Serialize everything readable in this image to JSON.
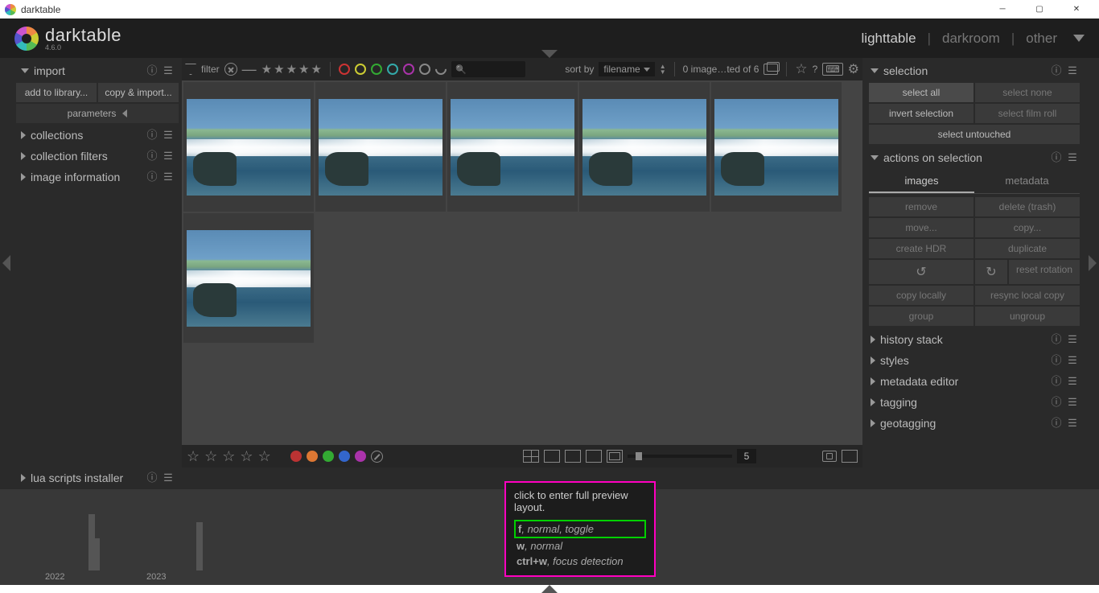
{
  "window": {
    "title": "darktable"
  },
  "app": {
    "name": "darktable",
    "version": "4.6.0"
  },
  "header_tabs": {
    "lighttable": "lighttable",
    "darkroom": "darkroom",
    "other": "other"
  },
  "left_panel": {
    "import": {
      "title": "import",
      "add_to_library": "add to library...",
      "copy_import": "copy & import...",
      "parameters": "parameters"
    },
    "collections": "collections",
    "collection_filters": "collection filters",
    "image_information": "image information",
    "lua": "lua scripts installer"
  },
  "toolbar": {
    "filter_label": "filter",
    "sort_by": "sort by",
    "sort_field": "filename",
    "count_text": "0 image…ted of 6",
    "zoom_value": "5",
    "colors": {
      "red": "#c33",
      "yellow": "#cc3",
      "green": "#3a3",
      "cyan": "#3aa",
      "magenta": "#a3a",
      "grey": "#888"
    },
    "dots": {
      "red": "#b33",
      "orange": "#d73",
      "green": "#3a3",
      "blue": "#36c",
      "magenta": "#a3a"
    }
  },
  "right_panel": {
    "selection": {
      "title": "selection",
      "select_all": "select all",
      "select_none": "select none",
      "invert": "invert selection",
      "film_roll": "select film roll",
      "untouched": "select untouched"
    },
    "actions": {
      "title": "actions on selection",
      "tab_images": "images",
      "tab_metadata": "metadata",
      "remove": "remove",
      "delete": "delete (trash)",
      "move": "move...",
      "copy": "copy...",
      "hdr": "create HDR",
      "duplicate": "duplicate",
      "reset_rot": "reset rotation",
      "copy_locally": "copy locally",
      "resync": "resync local copy",
      "group": "group",
      "ungroup": "ungroup"
    },
    "history_stack": "history stack",
    "styles": "styles",
    "metadata_editor": "metadata editor",
    "tagging": "tagging",
    "geotagging": "geotagging"
  },
  "tooltip": {
    "title": "click to enter full preview layout.",
    "rows": [
      {
        "key": "f",
        "desc": ", normal, toggle",
        "hl": true
      },
      {
        "key": "w",
        "desc": ", normal",
        "hl": false
      },
      {
        "key": "ctrl+w",
        "desc": ", focus detection",
        "hl": false
      }
    ]
  },
  "timeline": {
    "years": [
      "2022",
      "2023"
    ]
  }
}
